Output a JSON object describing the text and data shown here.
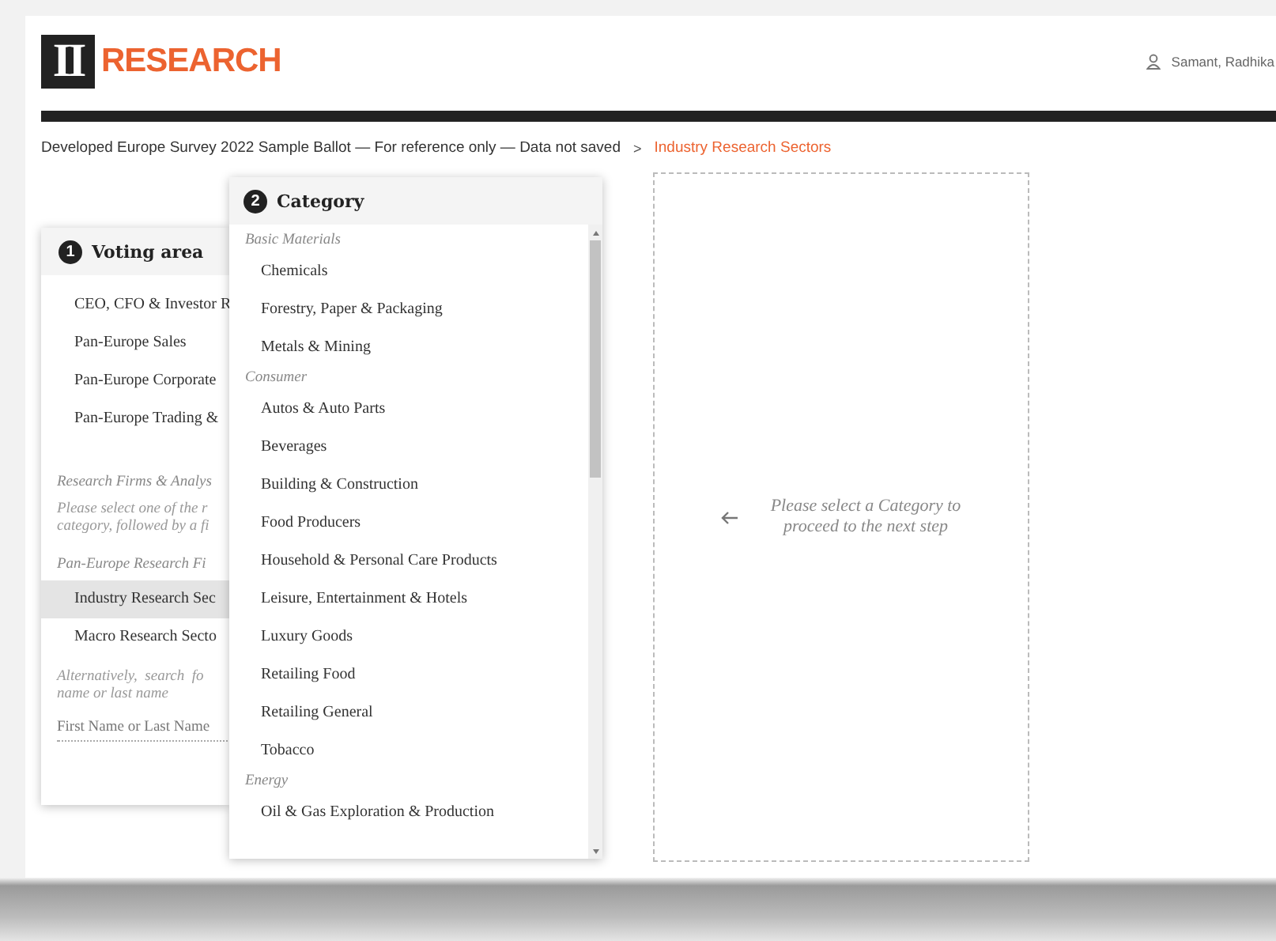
{
  "logo": {
    "mark": "II",
    "word": "RESEARCH"
  },
  "user": {
    "name": "Samant, Radhika"
  },
  "breadcrumb": [
    {
      "label": "Developed Europe Survey 2022 Sample Ballot — For reference only — Data not saved",
      "current": false
    },
    {
      "label": "Industry Research Sectors",
      "current": true
    }
  ],
  "breadcrumb_separator": ">",
  "voting_area": {
    "step": "1",
    "title": "Voting area",
    "sections": [
      {
        "kind": "items",
        "items": [
          {
            "label": "CEO, CFO & Investor R",
            "selected": false
          },
          {
            "label": "Pan-Europe Sales",
            "selected": false
          },
          {
            "label": "Pan-Europe Corporate",
            "selected": false
          },
          {
            "label": "Pan-Europe Trading &",
            "selected": false
          }
        ]
      },
      {
        "kind": "heading",
        "text": "Research Firms & Analys"
      },
      {
        "kind": "note",
        "text": "Please select one of the r\ncategory, followed by a fi"
      },
      {
        "kind": "heading",
        "text": "Pan-Europe Research Fi"
      },
      {
        "kind": "items",
        "items": [
          {
            "label": "Industry Research Sec",
            "selected": true
          },
          {
            "label": "Macro Research Secto",
            "selected": false
          }
        ]
      },
      {
        "kind": "note",
        "text": "Alternatively,  search  fo\nname or last name"
      },
      {
        "kind": "search",
        "placeholder": "First Name or Last Name"
      }
    ]
  },
  "category": {
    "step": "2",
    "title": "Category",
    "groups": [
      {
        "name": "Basic Materials",
        "items": [
          {
            "label": "Chemicals",
            "selected": false
          },
          {
            "label": "Forestry, Paper & Packaging",
            "selected": false
          },
          {
            "label": "Metals & Mining",
            "selected": false
          }
        ]
      },
      {
        "name": "Consumer",
        "items": [
          {
            "label": "Autos & Auto Parts",
            "selected": false
          },
          {
            "label": "Beverages",
            "selected": false
          },
          {
            "label": "Building & Construction",
            "selected": false
          },
          {
            "label": "Food Producers",
            "selected": false
          },
          {
            "label": "Household & Personal Care Products",
            "selected": false
          },
          {
            "label": "Leisure, Entertainment & Hotels",
            "selected": false
          },
          {
            "label": "Luxury Goods",
            "selected": false
          },
          {
            "label": "Retailing Food",
            "selected": false
          },
          {
            "label": "Retailing General",
            "selected": false
          },
          {
            "label": "Tobacco",
            "selected": false
          }
        ]
      },
      {
        "name": "Energy",
        "items": [
          {
            "label": "Oil & Gas Exploration & Production",
            "selected": false
          }
        ]
      }
    ]
  },
  "next_step": {
    "message": "Please select a Category to\nproceed to the next step"
  }
}
